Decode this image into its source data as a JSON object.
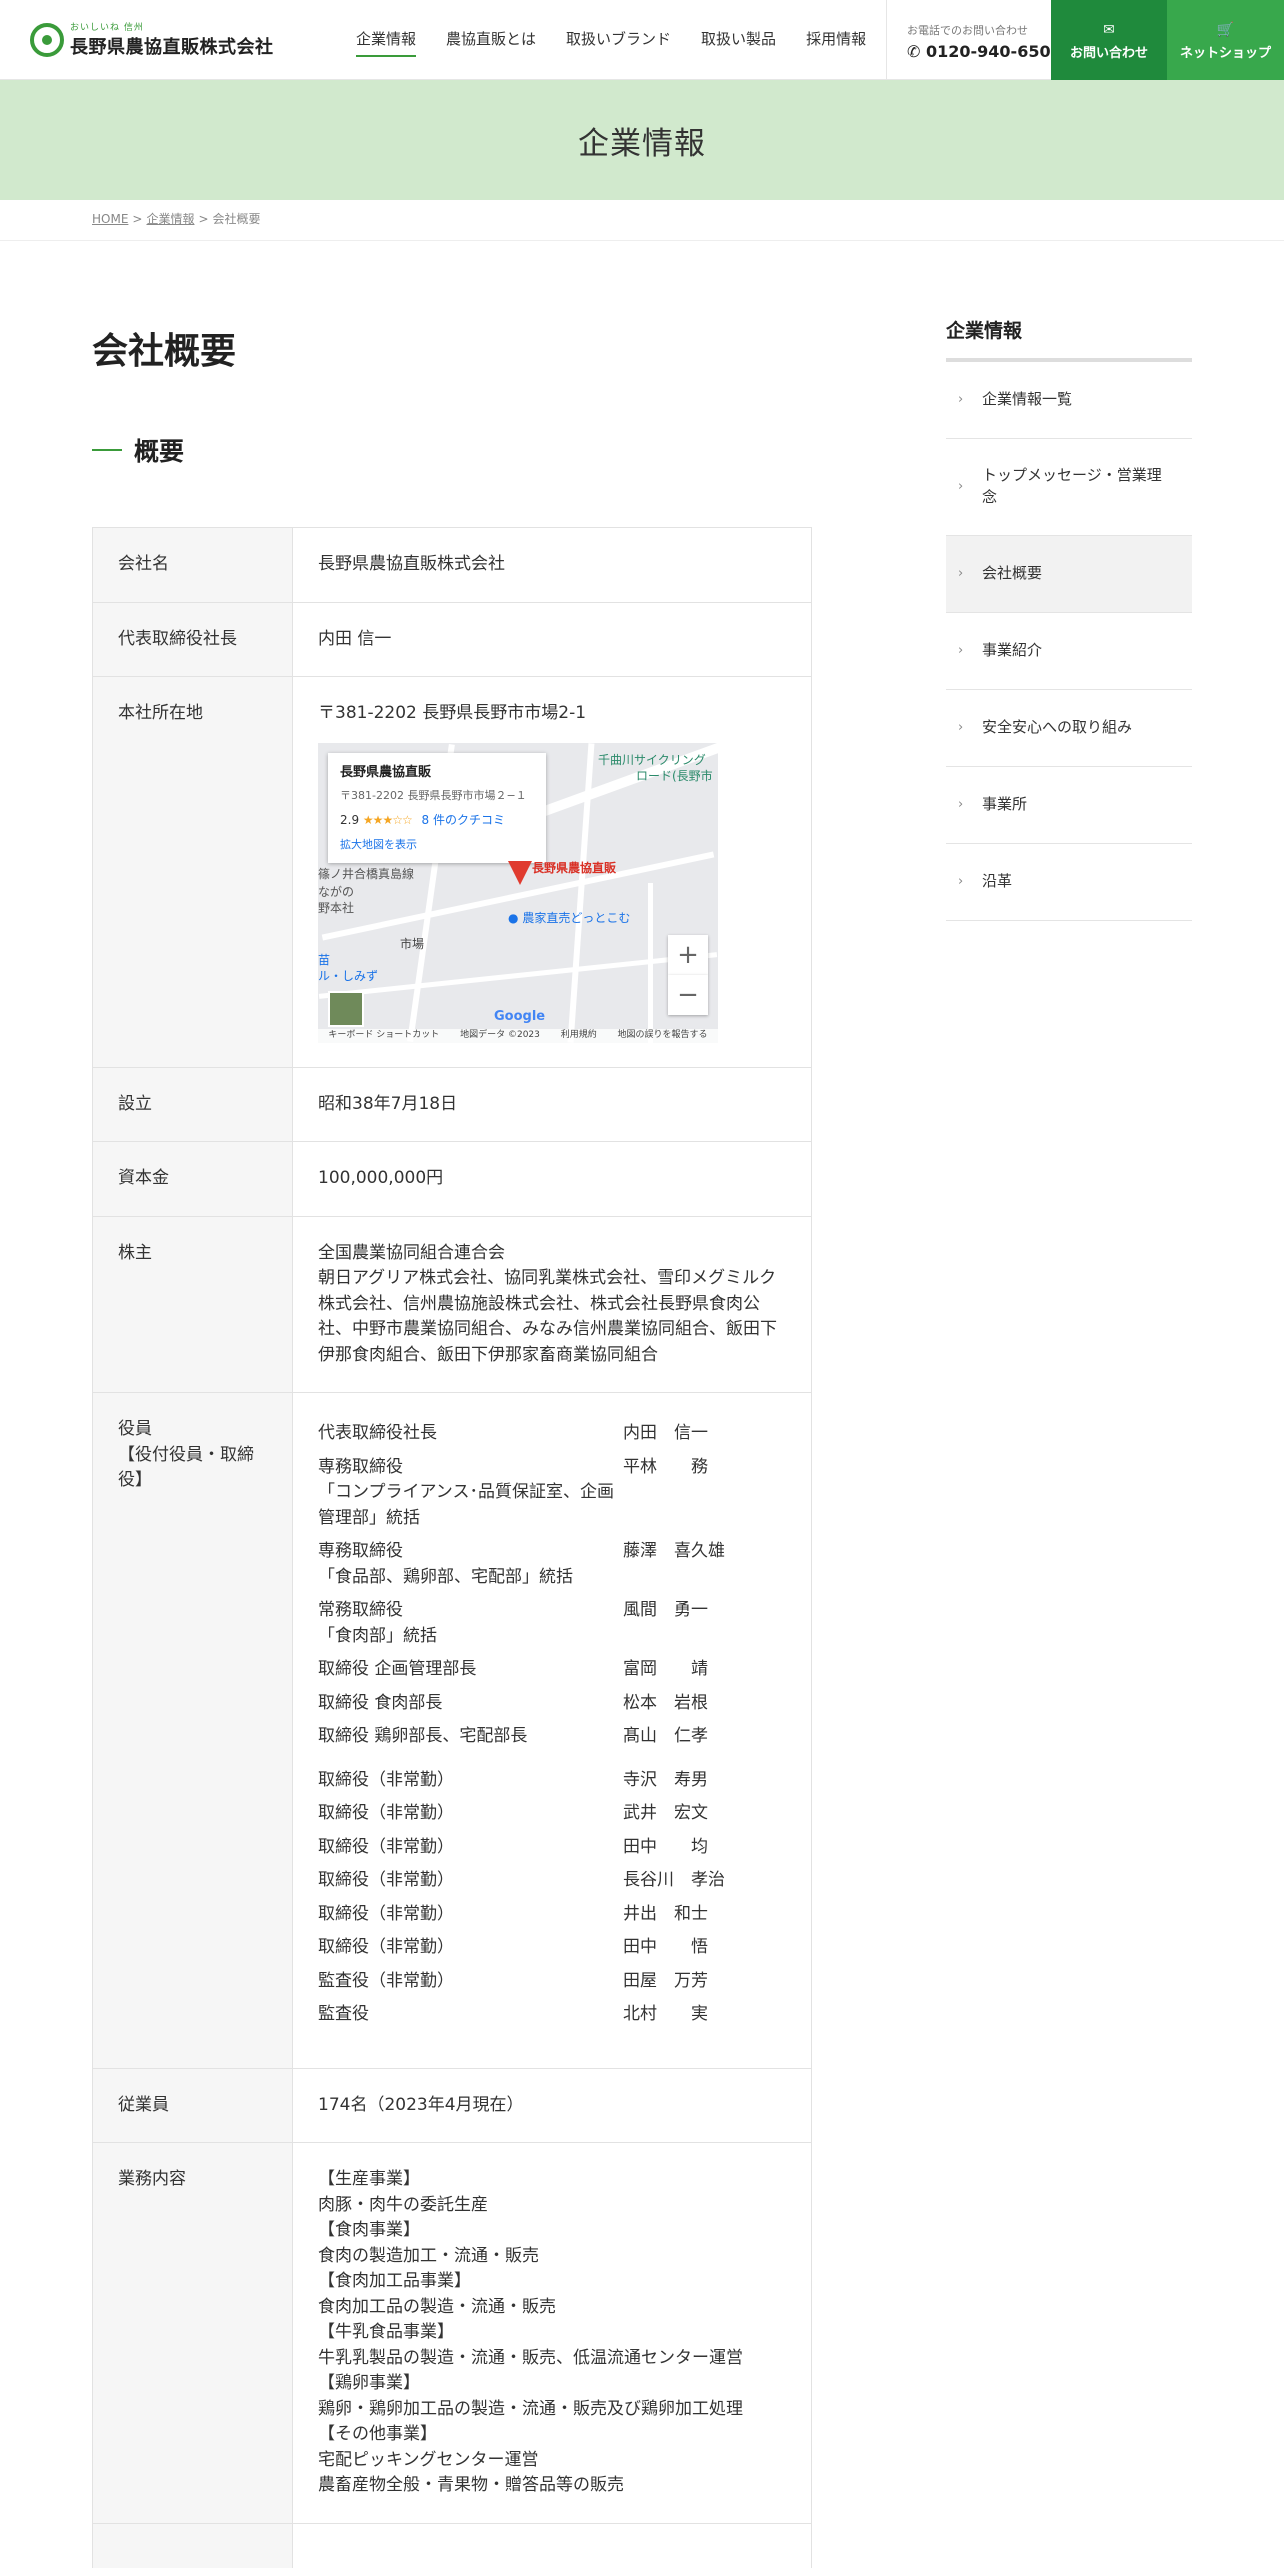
{
  "header": {
    "logo_sub": "おいしいね 信州",
    "logo_name": "長野県農協直販株式会社",
    "nav": [
      "企業情報",
      "農協直販とは",
      "取扱いブランド",
      "取扱い製品",
      "採用情報"
    ],
    "tel_label": "お電話でのお問い合わせ",
    "tel_number": "0120-940-650",
    "contact_label": "お問い合わせ",
    "shop_label": "ネットショップ"
  },
  "hero": {
    "title": "企業情報"
  },
  "breadcrumb": {
    "home": "HOME",
    "parent": "企業情報",
    "current": "会社概要",
    "sep": ">"
  },
  "main": {
    "page_title": "会社概要",
    "section_title": "概要",
    "rows": {
      "company": {
        "label": "会社名",
        "value": "長野県農協直販株式会社"
      },
      "ceo": {
        "label": "代表取締役社長",
        "value": "内田 信一"
      },
      "address": {
        "label": "本社所在地",
        "value": "〒381-2202 長野県長野市市場2-1"
      },
      "founded": {
        "label": "設立",
        "value": "昭和38年7月18日"
      },
      "capital": {
        "label": "資本金",
        "value": "100,000,000円"
      },
      "shareholders": {
        "label": "株主",
        "line1": "全国農業協同組合連合会",
        "line2": "朝日アグリア株式会社、協同乳業株式会社、雪印メグミルク株式会社、信州農協施設株式会社、株式会社長野県食肉公社、中野市農業協同組合、みなみ信州農業協同組合、飯田下伊那食肉組合、飯田下伊那家畜商業協同組合"
      },
      "officers": {
        "label": "役員",
        "label2": "【役付役員・取締役】"
      },
      "employees": {
        "label": "従業員",
        "value": "174名（2023年4月現在）"
      },
      "business": {
        "label": "業務内容",
        "lines": [
          "【生産事業】",
          "肉豚・肉牛の委託生産",
          "【食肉事業】",
          "食肉の製造加工・流通・販売",
          "【食肉加工品事業】",
          "食肉加工品の製造・流通・販売",
          "【牛乳食品事業】",
          "牛乳乳製品の製造・流通・販売、低温流通センター運営",
          "【鶏卵事業】",
          "鶏卵・鶏卵加工品の製造・流通・販売及び鶏卵加工処理",
          "【その他事業】",
          "宅配ピッキングセンター運営",
          "農畜産物全般・青果物・贈答品等の販売"
        ]
      }
    },
    "officers": [
      {
        "role": "代表取締役社長",
        "name": "内田　信一"
      },
      {
        "role": "専務取締役",
        "role2": "「コンプライアンス･品質保証室、企画管理部」統括",
        "name": "平林　　務"
      },
      {
        "role": "専務取締役",
        "role2": "「食品部、鶏卵部、宅配部」統括",
        "name": "藤澤　喜久雄"
      },
      {
        "role": "常務取締役",
        "role2": "「食肉部」統括",
        "name": "風間　勇一"
      },
      {
        "role": "取締役 企画管理部長",
        "name": "富岡　　靖"
      },
      {
        "role": "取締役 食肉部長",
        "name": "松本　岩根"
      },
      {
        "role": "取締役 鶏卵部長、宅配部長",
        "name": "髙山　仁孝"
      },
      {
        "role": "取締役（非常勤）",
        "name": "寺沢　寿男"
      },
      {
        "role": "取締役（非常勤）",
        "name": "武井　宏文"
      },
      {
        "role": "取締役（非常勤）",
        "name": "田中　　均"
      },
      {
        "role": "取締役（非常勤）",
        "name": "長谷川　孝治"
      },
      {
        "role": "取締役（非常勤）",
        "name": "井出　和士"
      },
      {
        "role": "取締役（非常勤）",
        "name": "田中　　悟"
      },
      {
        "role": "監査役（非常勤）",
        "name": "田屋　万芳"
      },
      {
        "role": "監査役",
        "name": "北村　　実"
      }
    ],
    "map": {
      "place_name": "長野県農協直販",
      "place_address": "〒381-2202 長野県長野市市場２−１",
      "rating": "2.9",
      "stars": "★★★☆☆",
      "reviews": "8 件のクチコミ",
      "enlarge": "拡大地図を表示",
      "pin_label": "長野県農協直販",
      "label_river": "千曲川サイクリング",
      "label_river2": "ロード(長野市",
      "label_rail": "篠ノ井合橋真島線",
      "label_poi1": "農家直売どっとこむ",
      "label_poi2": "ながの",
      "label_poi3": "野本社",
      "label_market": "市場",
      "label_hall": "苗",
      "label_hall2": "ル・しみず",
      "zoom_in": "+",
      "zoom_out": "−",
      "google": "Google",
      "footer": [
        "キーボード ショートカット",
        "地図データ ©2023",
        "利用規約",
        "地図の誤りを報告する"
      ]
    }
  },
  "sidebar": {
    "title": "企業情報",
    "items": [
      "企業情報一覧",
      "トップメッセージ・営業理念",
      "会社概要",
      "事業紹介",
      "安全安心への取り組み",
      "事業所",
      "沿革"
    ],
    "active_index": 2
  },
  "icons": {
    "contact": "mail-icon",
    "shop": "cart-icon",
    "tel": "phone-icon",
    "chevron": "chevron-right-icon"
  },
  "colors": {
    "brand_green": "#1f8a3c",
    "shop_green": "#38a84c",
    "hero_bg": "#d1e9cd"
  }
}
